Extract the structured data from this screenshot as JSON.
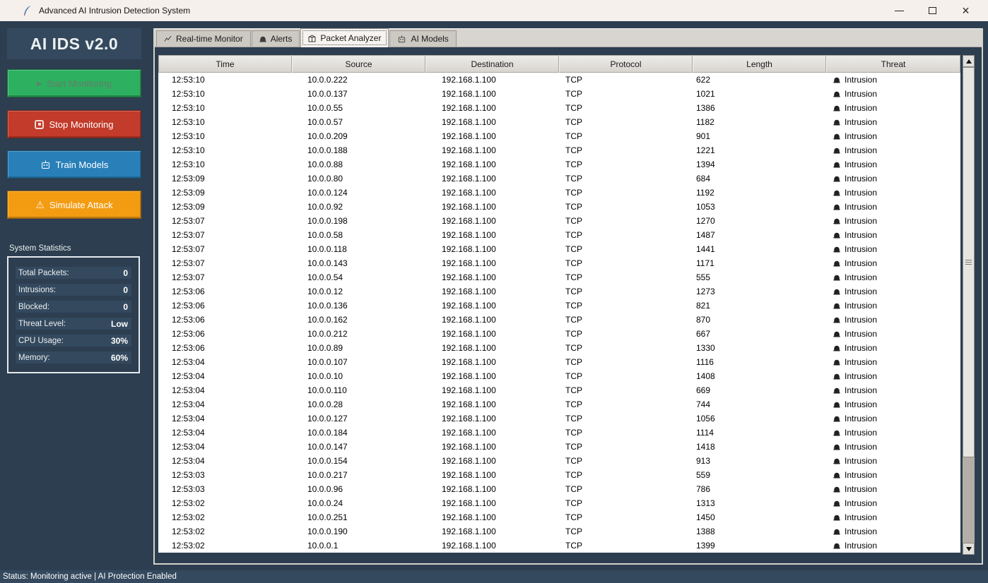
{
  "window": {
    "title": "Advanced AI Intrusion Detection System",
    "control_icons": [
      "minimize-icon",
      "maximize-icon",
      "close-icon"
    ],
    "app_icon": "feather-icon"
  },
  "sidebar": {
    "app_title": "AI IDS v2.0",
    "buttons": [
      {
        "label": "Start Monitoring",
        "icon": "play-icon",
        "color": "#2DB05F",
        "enabled": false
      },
      {
        "label": "Stop Monitoring",
        "icon": "stop-icon",
        "color": "#C23B2B",
        "enabled": true
      },
      {
        "label": "Train Models",
        "icon": "robot-icon",
        "color": "#2980B9",
        "enabled": true
      },
      {
        "label": "Simulate Attack",
        "icon": "warning-icon",
        "color": "#F39C12",
        "enabled": true
      }
    ],
    "stats": {
      "heading": "System Statistics",
      "rows": [
        {
          "label": "Total Packets:",
          "value": "0"
        },
        {
          "label": "Intrusions:",
          "value": "0"
        },
        {
          "label": "Blocked:",
          "value": "0"
        },
        {
          "label": "Threat Level:",
          "value": "Low"
        },
        {
          "label": "CPU Usage:",
          "value": "30%"
        },
        {
          "label": "Memory:",
          "value": "60%"
        }
      ]
    }
  },
  "tabs": [
    {
      "label": "Real-time Monitor",
      "icon": "chart-icon",
      "selected": false
    },
    {
      "label": "Alerts",
      "icon": "siren-icon",
      "selected": false
    },
    {
      "label": "Packet Analyzer",
      "icon": "package-icon",
      "selected": true
    },
    {
      "label": "AI Models",
      "icon": "robot-icon",
      "selected": false
    }
  ],
  "table": {
    "columns": [
      "Time",
      "Source",
      "Destination",
      "Protocol",
      "Length",
      "Threat"
    ],
    "threat_icon": "siren-icon",
    "scrollbar_icons": [
      "arrow-up-icon",
      "arrow-down-icon"
    ],
    "rows": [
      [
        "12:53:10",
        "10.0.0.222",
        "192.168.1.100",
        "TCP",
        "622",
        "Intrusion"
      ],
      [
        "12:53:10",
        "10.0.0.137",
        "192.168.1.100",
        "TCP",
        "1021",
        "Intrusion"
      ],
      [
        "12:53:10",
        "10.0.0.55",
        "192.168.1.100",
        "TCP",
        "1386",
        "Intrusion"
      ],
      [
        "12:53:10",
        "10.0.0.57",
        "192.168.1.100",
        "TCP",
        "1182",
        "Intrusion"
      ],
      [
        "12:53:10",
        "10.0.0.209",
        "192.168.1.100",
        "TCP",
        "901",
        "Intrusion"
      ],
      [
        "12:53:10",
        "10.0.0.188",
        "192.168.1.100",
        "TCP",
        "1221",
        "Intrusion"
      ],
      [
        "12:53:10",
        "10.0.0.88",
        "192.168.1.100",
        "TCP",
        "1394",
        "Intrusion"
      ],
      [
        "12:53:09",
        "10.0.0.80",
        "192.168.1.100",
        "TCP",
        "684",
        "Intrusion"
      ],
      [
        "12:53:09",
        "10.0.0.124",
        "192.168.1.100",
        "TCP",
        "1192",
        "Intrusion"
      ],
      [
        "12:53:09",
        "10.0.0.92",
        "192.168.1.100",
        "TCP",
        "1053",
        "Intrusion"
      ],
      [
        "12:53:07",
        "10.0.0.198",
        "192.168.1.100",
        "TCP",
        "1270",
        "Intrusion"
      ],
      [
        "12:53:07",
        "10.0.0.58",
        "192.168.1.100",
        "TCP",
        "1487",
        "Intrusion"
      ],
      [
        "12:53:07",
        "10.0.0.118",
        "192.168.1.100",
        "TCP",
        "1441",
        "Intrusion"
      ],
      [
        "12:53:07",
        "10.0.0.143",
        "192.168.1.100",
        "TCP",
        "1171",
        "Intrusion"
      ],
      [
        "12:53:07",
        "10.0.0.54",
        "192.168.1.100",
        "TCP",
        "555",
        "Intrusion"
      ],
      [
        "12:53:06",
        "10.0.0.12",
        "192.168.1.100",
        "TCP",
        "1273",
        "Intrusion"
      ],
      [
        "12:53:06",
        "10.0.0.136",
        "192.168.1.100",
        "TCP",
        "821",
        "Intrusion"
      ],
      [
        "12:53:06",
        "10.0.0.162",
        "192.168.1.100",
        "TCP",
        "870",
        "Intrusion"
      ],
      [
        "12:53:06",
        "10.0.0.212",
        "192.168.1.100",
        "TCP",
        "667",
        "Intrusion"
      ],
      [
        "12:53:06",
        "10.0.0.89",
        "192.168.1.100",
        "TCP",
        "1330",
        "Intrusion"
      ],
      [
        "12:53:04",
        "10.0.0.107",
        "192.168.1.100",
        "TCP",
        "1116",
        "Intrusion"
      ],
      [
        "12:53:04",
        "10.0.0.10",
        "192.168.1.100",
        "TCP",
        "1408",
        "Intrusion"
      ],
      [
        "12:53:04",
        "10.0.0.110",
        "192.168.1.100",
        "TCP",
        "669",
        "Intrusion"
      ],
      [
        "12:53:04",
        "10.0.0.28",
        "192.168.1.100",
        "TCP",
        "744",
        "Intrusion"
      ],
      [
        "12:53:04",
        "10.0.0.127",
        "192.168.1.100",
        "TCP",
        "1056",
        "Intrusion"
      ],
      [
        "12:53:04",
        "10.0.0.184",
        "192.168.1.100",
        "TCP",
        "1114",
        "Intrusion"
      ],
      [
        "12:53:04",
        "10.0.0.147",
        "192.168.1.100",
        "TCP",
        "1418",
        "Intrusion"
      ],
      [
        "12:53:04",
        "10.0.0.154",
        "192.168.1.100",
        "TCP",
        "913",
        "Intrusion"
      ],
      [
        "12:53:03",
        "10.0.0.217",
        "192.168.1.100",
        "TCP",
        "559",
        "Intrusion"
      ],
      [
        "12:53:03",
        "10.0.0.96",
        "192.168.1.100",
        "TCP",
        "786",
        "Intrusion"
      ],
      [
        "12:53:02",
        "10.0.0.24",
        "192.168.1.100",
        "TCP",
        "1313",
        "Intrusion"
      ],
      [
        "12:53:02",
        "10.0.0.251",
        "192.168.1.100",
        "TCP",
        "1450",
        "Intrusion"
      ],
      [
        "12:53:02",
        "10.0.0.190",
        "192.168.1.100",
        "TCP",
        "1388",
        "Intrusion"
      ],
      [
        "12:53:02",
        "10.0.0.1",
        "192.168.1.100",
        "TCP",
        "1399",
        "Intrusion"
      ]
    ]
  },
  "status_bar": {
    "text": "Status: Monitoring active | AI Protection Enabled"
  },
  "colors": {
    "sidebar_bg": "#2C3E50",
    "panel_bg": "#34495E",
    "start_green": "#2DB05F",
    "stop_red": "#C23B2B",
    "train_blue": "#2980B9",
    "attack_orange": "#F39C12",
    "tab_strip": "#D8D5D0",
    "tab_selected": "#F7F3F0",
    "table_bg": "#FFFFFF"
  }
}
